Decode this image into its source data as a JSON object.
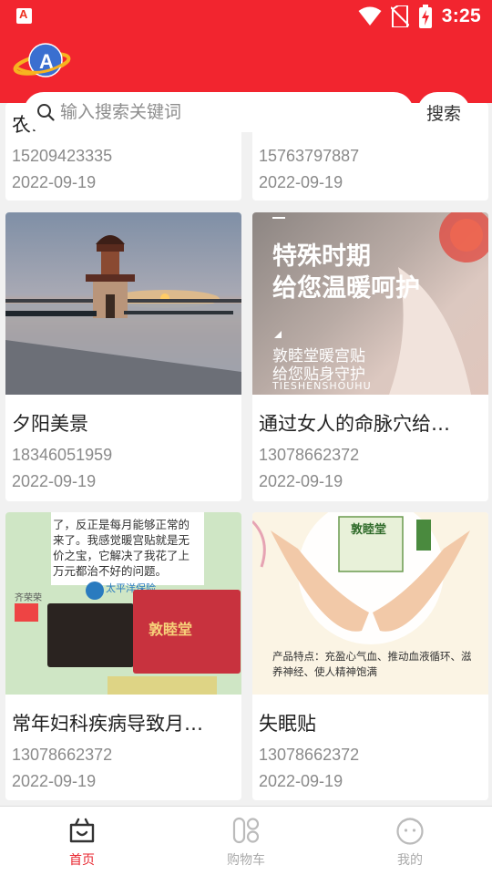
{
  "status_bar": {
    "time": "3:25"
  },
  "search": {
    "placeholder": "输入搜索关键词",
    "button_label": "搜索"
  },
  "cards": [
    {
      "title": "农…",
      "phone": "15209423335",
      "date": "2022-09-19"
    },
    {
      "title": "",
      "phone": "15763797887",
      "date": "2022-09-19"
    },
    {
      "title": "夕阳美景",
      "phone": "18346051959",
      "date": "2022-09-19",
      "image": "sunset-pavilion-photo"
    },
    {
      "title": "通过女人的命脉穴给…",
      "phone": "13078662372",
      "date": "2022-09-19",
      "image": "warm-patch-ad",
      "overlay": {
        "line1": "特殊时期",
        "line2": "给您温暖呵护",
        "line3": "敦睦堂暖宫贴",
        "line4": "给您贴身守护",
        "line5": "TIESHENSHOUHU"
      }
    },
    {
      "title": "常年妇科疾病导致月…",
      "phone": "13078662372",
      "date": "2022-09-19",
      "image": "chat-screenshot-product",
      "overlay": {
        "text1": "来了。我感觉暖宫贴就是无",
        "text2": "价之宝，它解决了我花了上",
        "text3": "万元都治不好的问题。",
        "text0": "了，反正是每月能够正常的",
        "brand": "太平洋保险",
        "product": "敦睦堂",
        "person": "齐荣荣"
      }
    },
    {
      "title": "失眠贴",
      "phone": "13078662372",
      "date": "2022-09-19",
      "image": "hands-product",
      "overlay": {
        "brand": "敦睦堂",
        "feature": "产品特点：充盈心气血、推动血液循环、滋养神经、使人精神饱满"
      }
    }
  ],
  "bottom_nav": [
    {
      "label": "首页",
      "icon": "home-bag-icon",
      "active": true
    },
    {
      "label": "购物车",
      "icon": "cart-icon",
      "active": false
    },
    {
      "label": "我的",
      "icon": "profile-icon",
      "active": false
    }
  ],
  "colors": {
    "brand_red": "#f2252f",
    "active_nav": "#e8262f"
  }
}
